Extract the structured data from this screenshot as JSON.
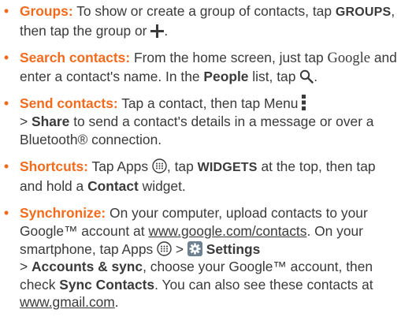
{
  "bullet_char": "•",
  "accent_color": "#f26b1d",
  "text_color": "#3a3a3a",
  "items": [
    {
      "head": "Groups:",
      "t1": "To show or create a group of contacts, tap",
      "cmd1": "GROUPS",
      "t2": ", then tap the group or",
      "icon": "plus-icon",
      "t3": "."
    },
    {
      "head": "Search contacts:",
      "t1": "From the home screen, just tap",
      "google": "Google",
      "t2": "and enter a contact's name. In the",
      "b1": "People",
      "t3": "list, tap",
      "icon": "search-icon",
      "t4": "."
    },
    {
      "head": "Send contacts:",
      "t1": "Tap a contact, then tap Menu",
      "icon": "menu-icon",
      "t2": ">",
      "b1": "Share",
      "t3": "to send a contact's details in a message or over a Bluetooth® connection."
    },
    {
      "head": "Shortcuts:",
      "t1": "Tap Apps",
      "icon": "apps-icon",
      "t2": ", tap",
      "cmd1": "WIDGETS",
      "t3": "at the top, then tap and hold a",
      "b1": "Contact",
      "t4": "widget."
    },
    {
      "head": "Synchronize:",
      "t1": "On your computer, upload contacts to your Google™ account at",
      "link1": "www.google.com/contacts",
      "t2": ". On your smartphone, tap Apps",
      "icon1": "apps-icon",
      "t3": ">",
      "icon2": "settings-gear-icon",
      "b1": "Settings",
      "t4": ">",
      "b2": "Accounts & sync",
      "t5": ", choose your Google™ account, then check",
      "b3": "Sync Contacts",
      "t6": ". You can also see these contacts at",
      "link2": "www.gmail.com",
      "t7": "."
    }
  ]
}
